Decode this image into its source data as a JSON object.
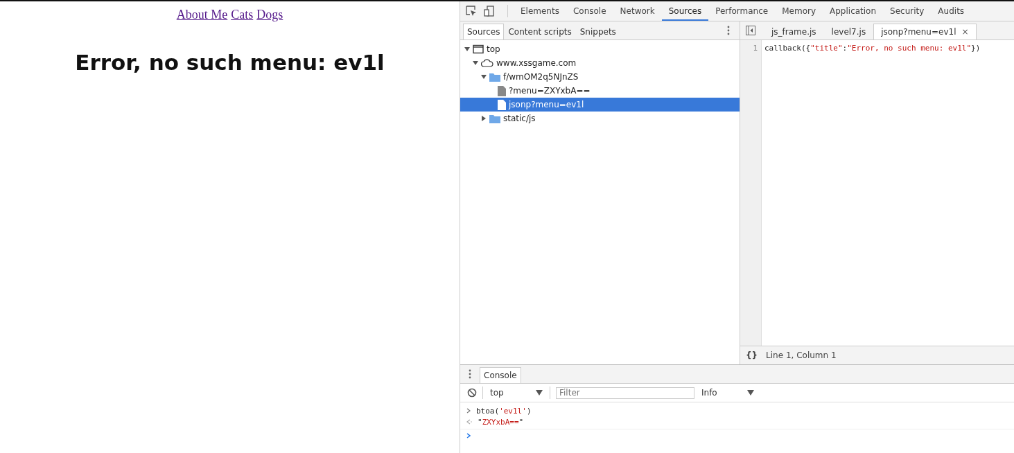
{
  "page": {
    "nav_links": [
      "About Me",
      "Cats",
      "Dogs"
    ],
    "heading": "Error, no such menu: ev1l"
  },
  "devtools": {
    "panel_tabs": [
      {
        "label": "Elements",
        "selected": false
      },
      {
        "label": "Console",
        "selected": false
      },
      {
        "label": "Network",
        "selected": false
      },
      {
        "label": "Sources",
        "selected": true
      },
      {
        "label": "Performance",
        "selected": false
      },
      {
        "label": "Memory",
        "selected": false
      },
      {
        "label": "Application",
        "selected": false
      },
      {
        "label": "Security",
        "selected": false
      },
      {
        "label": "Audits",
        "selected": false
      }
    ],
    "navigator_tabs": [
      {
        "label": "Sources",
        "selected": true
      },
      {
        "label": "Content scripts",
        "selected": false
      },
      {
        "label": "Snippets",
        "selected": false
      }
    ],
    "tree": [
      {
        "label": "top",
        "kind": "frame",
        "expanded": true,
        "selected": false,
        "children": [
          {
            "label": "www.xssgame.com",
            "kind": "domain",
            "expanded": true,
            "selected": false,
            "children": [
              {
                "label": "f/wmOM2q5NJnZS",
                "kind": "folder",
                "expanded": true,
                "selected": false,
                "children": [
                  {
                    "label": "?menu=ZXYxbA==",
                    "kind": "file",
                    "selected": false
                  },
                  {
                    "label": "jsonp?menu=ev1l",
                    "kind": "file",
                    "selected": true
                  }
                ]
              },
              {
                "label": "static/js",
                "kind": "folder",
                "expanded": false,
                "selected": false
              }
            ]
          }
        ]
      }
    ],
    "editor_tabs": [
      {
        "label": "js_frame.js",
        "selected": false
      },
      {
        "label": "level7.js",
        "selected": false
      },
      {
        "label": "jsonp?menu=ev1l",
        "selected": true,
        "close": "×"
      }
    ],
    "code_lines": [
      {
        "number": "1",
        "tokens": [
          {
            "text": "callback({",
            "kind": "plain"
          },
          {
            "text": "\"title\"",
            "kind": "string"
          },
          {
            "text": ":",
            "kind": "plain"
          },
          {
            "text": "\"Error, no such menu: ev1l\"",
            "kind": "string"
          },
          {
            "text": "})",
            "kind": "plain"
          }
        ]
      }
    ],
    "format_glyph": "{}",
    "status": "Line 1, Column 1",
    "drawer_tabs": [
      {
        "label": "Console",
        "selected": true
      }
    ],
    "console_context": "top",
    "filter_placeholder": "Filter",
    "log_level": "Info",
    "console_messages": [
      {
        "kind": "input",
        "tokens": [
          {
            "text": "btoa(",
            "kind": "plain"
          },
          {
            "text": "'ev1l'",
            "kind": "string"
          },
          {
            "text": ")",
            "kind": "plain"
          }
        ]
      },
      {
        "kind": "result",
        "tokens": [
          {
            "text": "\"",
            "kind": "plain"
          },
          {
            "text": "ZXYxbA==",
            "kind": "string"
          },
          {
            "text": "\"",
            "kind": "plain"
          }
        ]
      }
    ]
  }
}
